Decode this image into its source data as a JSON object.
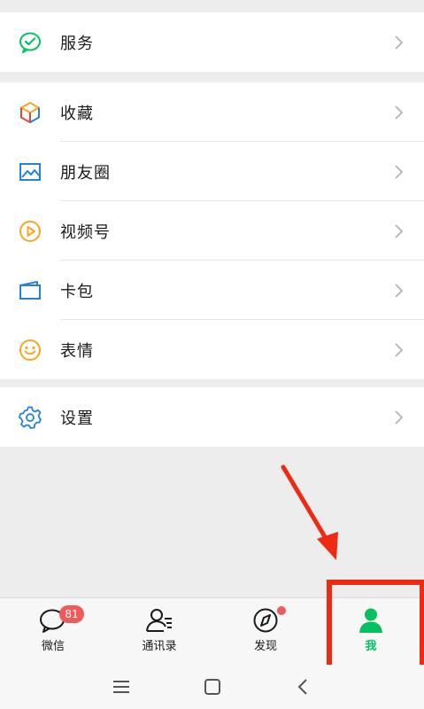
{
  "menu": {
    "services": "服务",
    "favorites": "收藏",
    "moments": "朋友圈",
    "channels": "视频号",
    "cards": "卡包",
    "stickers": "表情",
    "settings": "设置"
  },
  "tabbar": {
    "chats": {
      "label": "微信",
      "badge": "81"
    },
    "contacts": {
      "label": "通讯录"
    },
    "discover": {
      "label": "发现"
    },
    "me": {
      "label": "我"
    }
  },
  "colors": {
    "active_tab": "#07c160",
    "badge": "#f05a5a",
    "annotation": "#ee2a12"
  },
  "icons": {
    "services": "wechat-pay-icon",
    "favorites": "cube-icon",
    "moments": "image-icon",
    "channels": "play-circle-icon",
    "cards": "wallet-icon",
    "stickers": "smiley-icon",
    "settings": "gear-icon"
  }
}
